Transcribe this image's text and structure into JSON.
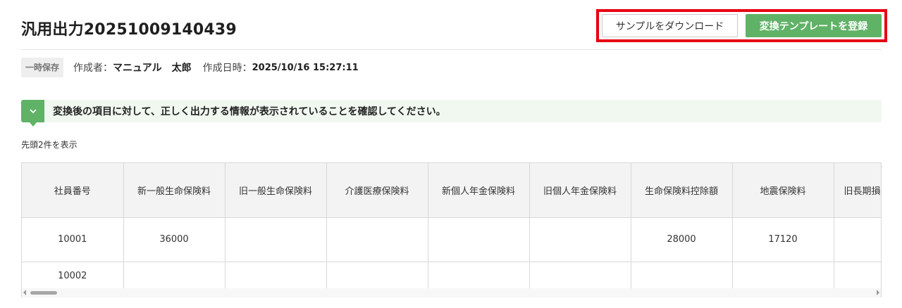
{
  "header": {
    "title": "汎用出力20251009140439",
    "sample_download_label": "サンプルをダウンロード",
    "register_template_label": "変換テンプレートを登録"
  },
  "meta": {
    "status": "一時保存",
    "author_label": "作成者：",
    "author": "マニュアル　太郎",
    "created_label": "作成日時：",
    "created_at": "2025/10/16 15:27:11"
  },
  "notice": {
    "text": "変換後の項目に対して、正しく出力する情報が表示されていることを確認してください。"
  },
  "preview": {
    "caption": "先頭2件を表示",
    "columns": [
      "社員番号",
      "新一般生命保険料",
      "旧一般生命保険料",
      "介護医療保険料",
      "新個人年金保険料",
      "旧個人年金保険料",
      "生命保険料控除額",
      "地震保険料",
      "旧長期損"
    ],
    "rows": [
      [
        "10001",
        "36000",
        "",
        "",
        "",
        "",
        "28000",
        "17120",
        ""
      ],
      [
        "10002",
        "",
        "",
        "",
        "",
        "",
        "",
        "",
        ""
      ]
    ]
  },
  "colors": {
    "accent_green": "#5fb266",
    "highlight_red": "#e60012"
  }
}
